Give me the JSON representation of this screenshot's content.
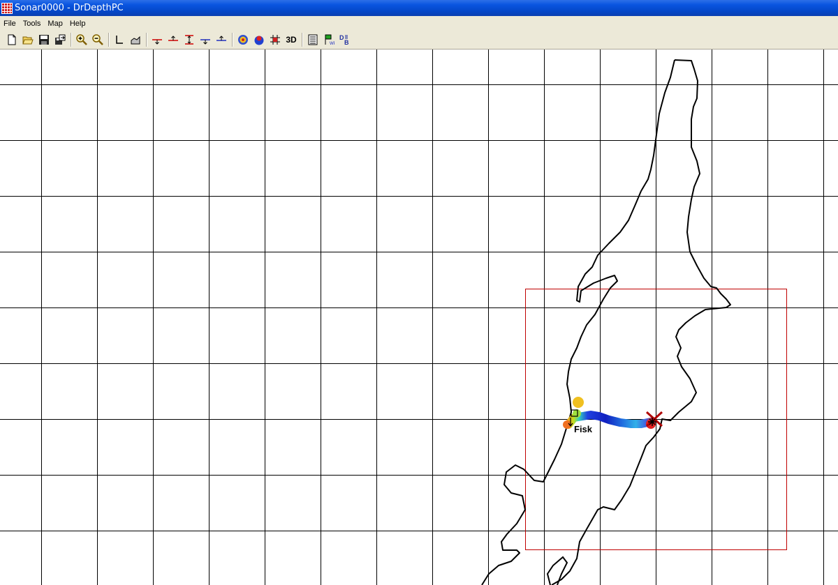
{
  "window": {
    "title": "Sonar0000 - DrDepthPC"
  },
  "menu": {
    "items": [
      "File",
      "Tools",
      "Map",
      "Help"
    ]
  },
  "toolbar": {
    "buttons": [
      {
        "icon": "new-file-icon"
      },
      {
        "icon": "open-folder-icon"
      },
      {
        "icon": "save-icon"
      },
      {
        "icon": "export-icon"
      },
      {
        "icon": "zoom-in-icon"
      },
      {
        "icon": "zoom-out-icon"
      },
      {
        "icon": "axis-icon"
      },
      {
        "icon": "profile-icon"
      },
      {
        "icon": "depth-down-icon"
      },
      {
        "icon": "depth-up-icon"
      },
      {
        "icon": "depth-range-icon"
      },
      {
        "icon": "shallow-down-icon"
      },
      {
        "icon": "shallow-up-icon"
      },
      {
        "icon": "contour-map-icon"
      },
      {
        "icon": "depth-color-icon"
      },
      {
        "icon": "grid-mark-icon"
      },
      {
        "icon": "waypoint-list-icon"
      },
      {
        "icon": "waypoint-flag-icon"
      },
      {
        "icon": "database-icon"
      }
    ],
    "three_d_label": "3D"
  },
  "map": {
    "waypoint_label": "Fisk",
    "colors": {
      "grid_line": "#000000",
      "selection_rect": "#c00000",
      "shoreline": "#000000",
      "end_marker": "#b00000"
    }
  }
}
